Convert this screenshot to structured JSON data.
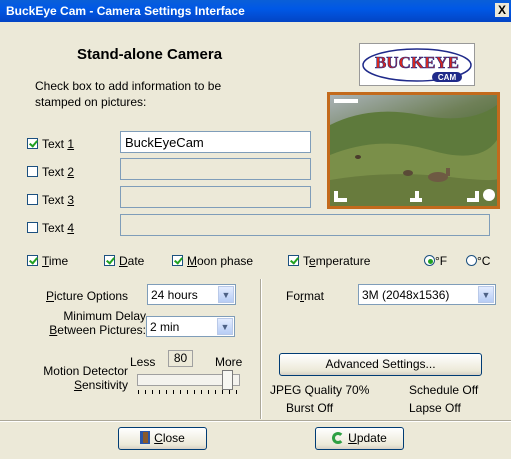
{
  "window": {
    "title": "BuckEye Cam - Camera Settings Interface",
    "close_glyph": "X"
  },
  "heading": "Stand-alone Camera",
  "instructions": "Check box to add information to be stamped on pictures:",
  "logo": {
    "text": "BUCKEYE CAM",
    "colors": {
      "primary": "#d8281e",
      "secondary": "#1f2a8a"
    }
  },
  "text_fields": [
    {
      "label": "Text",
      "mnemonic": "1",
      "checked": true,
      "value": "BuckEyeCam"
    },
    {
      "label": "Text",
      "mnemonic": "2",
      "checked": false,
      "value": ""
    },
    {
      "label": "Text",
      "mnemonic": "3",
      "checked": false,
      "value": ""
    },
    {
      "label": "Text",
      "mnemonic": "4",
      "checked": false,
      "value": ""
    }
  ],
  "stamp_options": [
    {
      "pre": "",
      "ul": "T",
      "post": "ime",
      "checked": true
    },
    {
      "pre": "",
      "ul": "D",
      "post": "ate",
      "checked": true
    },
    {
      "pre": "",
      "ul": "M",
      "post": "oon phase",
      "checked": true
    },
    {
      "pre": "T",
      "ul": "e",
      "post": "mperature",
      "checked": true
    }
  ],
  "temp_units": [
    {
      "symbol": "°F",
      "selected": true
    },
    {
      "symbol": "°C",
      "selected": false
    }
  ],
  "picture_options": {
    "pre": "",
    "ul": "P",
    "post": "icture Options",
    "value": "24 hours"
  },
  "min_delay": {
    "label_line1": "Minimum Delay",
    "label_line2_ul": "B",
    "label_line2_rest": "etween Pictures:",
    "value": "2 min"
  },
  "format": {
    "pre": "Fo",
    "ul": "r",
    "post": "mat",
    "value": "3M (2048x1536)"
  },
  "motion": {
    "label_line1": "Motion Detector",
    "label_line2_ul": "S",
    "label_line2_rest": "ensitivity",
    "less": "Less",
    "more": "More",
    "value": "80"
  },
  "advanced_button": "Advanced Settings...",
  "status": {
    "jpeg_quality": "JPEG Quality 70%",
    "schedule": "Schedule Off",
    "burst": "Burst Off",
    "lapse": "Lapse Off"
  },
  "buttons": {
    "close_ul": "C",
    "close_rest": "lose",
    "update_ul": "U",
    "update_rest": "pdate"
  }
}
